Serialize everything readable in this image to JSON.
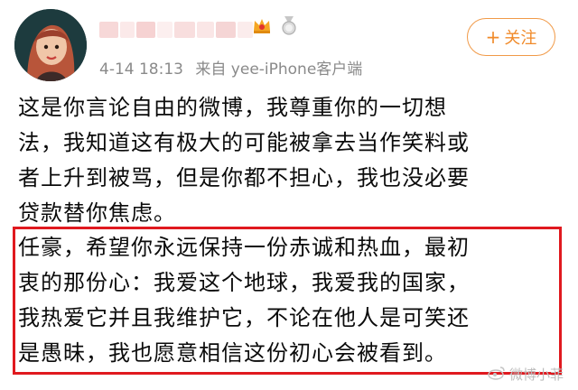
{
  "post": {
    "timestamp": "4-14 18:13",
    "source": "来自 yee-iPhone客户端",
    "paragraph_lines": [
      "这是你言论自由的微博，我尊重你的一切想",
      "法，我知道这有极大的可能被拿去当作笑料或",
      "者上升到被骂，但是你都不担心，我也没必要",
      "贷款替你焦虑。"
    ],
    "highlight_lines": [
      "任豪，希望你永远保持一份赤诚和热血，最初",
      "衷的那份心：我爱这个地球，我爱我的国家，",
      "我热爱它并且我维护它，不论在他人是可笑还",
      "是愚昧，我也愿意相信这份初心会被看到。"
    ]
  },
  "follow_button": {
    "plus": "+",
    "label": "关注"
  },
  "watermark": {
    "text": "微博小菲"
  },
  "colors": {
    "accent": "#f08a2a",
    "highlight_border": "#e0191f",
    "meta": "#8a8a8a"
  },
  "icons": [
    "avatar",
    "crown-icon",
    "medal-icon",
    "weibo-logo-icon"
  ]
}
